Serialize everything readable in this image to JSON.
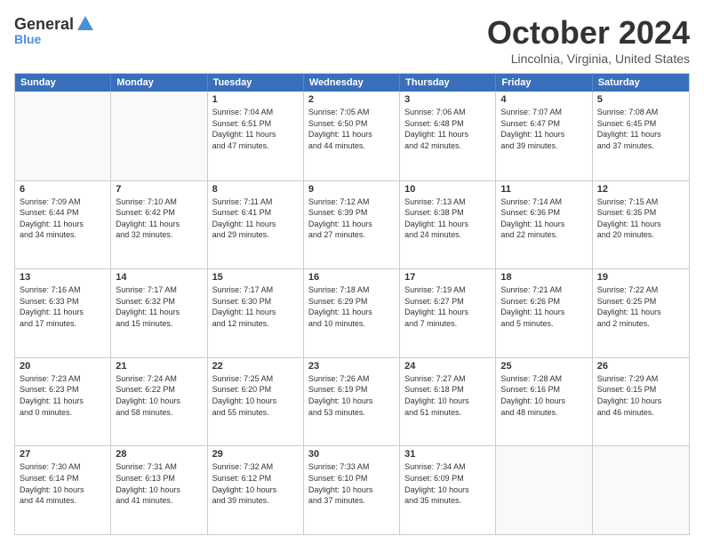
{
  "logo": {
    "general": "General",
    "blue": "Blue"
  },
  "header": {
    "month": "October 2024",
    "location": "Lincolnia, Virginia, United States"
  },
  "days": [
    "Sunday",
    "Monday",
    "Tuesday",
    "Wednesday",
    "Thursday",
    "Friday",
    "Saturday"
  ],
  "weeks": [
    [
      {
        "day": "",
        "empty": true
      },
      {
        "day": "",
        "empty": true
      },
      {
        "day": "1",
        "lines": [
          "Sunrise: 7:04 AM",
          "Sunset: 6:51 PM",
          "Daylight: 11 hours",
          "and 47 minutes."
        ]
      },
      {
        "day": "2",
        "lines": [
          "Sunrise: 7:05 AM",
          "Sunset: 6:50 PM",
          "Daylight: 11 hours",
          "and 44 minutes."
        ]
      },
      {
        "day": "3",
        "lines": [
          "Sunrise: 7:06 AM",
          "Sunset: 6:48 PM",
          "Daylight: 11 hours",
          "and 42 minutes."
        ]
      },
      {
        "day": "4",
        "lines": [
          "Sunrise: 7:07 AM",
          "Sunset: 6:47 PM",
          "Daylight: 11 hours",
          "and 39 minutes."
        ]
      },
      {
        "day": "5",
        "lines": [
          "Sunrise: 7:08 AM",
          "Sunset: 6:45 PM",
          "Daylight: 11 hours",
          "and 37 minutes."
        ]
      }
    ],
    [
      {
        "day": "6",
        "lines": [
          "Sunrise: 7:09 AM",
          "Sunset: 6:44 PM",
          "Daylight: 11 hours",
          "and 34 minutes."
        ]
      },
      {
        "day": "7",
        "lines": [
          "Sunrise: 7:10 AM",
          "Sunset: 6:42 PM",
          "Daylight: 11 hours",
          "and 32 minutes."
        ]
      },
      {
        "day": "8",
        "lines": [
          "Sunrise: 7:11 AM",
          "Sunset: 6:41 PM",
          "Daylight: 11 hours",
          "and 29 minutes."
        ]
      },
      {
        "day": "9",
        "lines": [
          "Sunrise: 7:12 AM",
          "Sunset: 6:39 PM",
          "Daylight: 11 hours",
          "and 27 minutes."
        ]
      },
      {
        "day": "10",
        "lines": [
          "Sunrise: 7:13 AM",
          "Sunset: 6:38 PM",
          "Daylight: 11 hours",
          "and 24 minutes."
        ]
      },
      {
        "day": "11",
        "lines": [
          "Sunrise: 7:14 AM",
          "Sunset: 6:36 PM",
          "Daylight: 11 hours",
          "and 22 minutes."
        ]
      },
      {
        "day": "12",
        "lines": [
          "Sunrise: 7:15 AM",
          "Sunset: 6:35 PM",
          "Daylight: 11 hours",
          "and 20 minutes."
        ]
      }
    ],
    [
      {
        "day": "13",
        "lines": [
          "Sunrise: 7:16 AM",
          "Sunset: 6:33 PM",
          "Daylight: 11 hours",
          "and 17 minutes."
        ]
      },
      {
        "day": "14",
        "lines": [
          "Sunrise: 7:17 AM",
          "Sunset: 6:32 PM",
          "Daylight: 11 hours",
          "and 15 minutes."
        ]
      },
      {
        "day": "15",
        "lines": [
          "Sunrise: 7:17 AM",
          "Sunset: 6:30 PM",
          "Daylight: 11 hours",
          "and 12 minutes."
        ]
      },
      {
        "day": "16",
        "lines": [
          "Sunrise: 7:18 AM",
          "Sunset: 6:29 PM",
          "Daylight: 11 hours",
          "and 10 minutes."
        ]
      },
      {
        "day": "17",
        "lines": [
          "Sunrise: 7:19 AM",
          "Sunset: 6:27 PM",
          "Daylight: 11 hours",
          "and 7 minutes."
        ]
      },
      {
        "day": "18",
        "lines": [
          "Sunrise: 7:21 AM",
          "Sunset: 6:26 PM",
          "Daylight: 11 hours",
          "and 5 minutes."
        ]
      },
      {
        "day": "19",
        "lines": [
          "Sunrise: 7:22 AM",
          "Sunset: 6:25 PM",
          "Daylight: 11 hours",
          "and 2 minutes."
        ]
      }
    ],
    [
      {
        "day": "20",
        "lines": [
          "Sunrise: 7:23 AM",
          "Sunset: 6:23 PM",
          "Daylight: 11 hours",
          "and 0 minutes."
        ]
      },
      {
        "day": "21",
        "lines": [
          "Sunrise: 7:24 AM",
          "Sunset: 6:22 PM",
          "Daylight: 10 hours",
          "and 58 minutes."
        ]
      },
      {
        "day": "22",
        "lines": [
          "Sunrise: 7:25 AM",
          "Sunset: 6:20 PM",
          "Daylight: 10 hours",
          "and 55 minutes."
        ]
      },
      {
        "day": "23",
        "lines": [
          "Sunrise: 7:26 AM",
          "Sunset: 6:19 PM",
          "Daylight: 10 hours",
          "and 53 minutes."
        ]
      },
      {
        "day": "24",
        "lines": [
          "Sunrise: 7:27 AM",
          "Sunset: 6:18 PM",
          "Daylight: 10 hours",
          "and 51 minutes."
        ]
      },
      {
        "day": "25",
        "lines": [
          "Sunrise: 7:28 AM",
          "Sunset: 6:16 PM",
          "Daylight: 10 hours",
          "and 48 minutes."
        ]
      },
      {
        "day": "26",
        "lines": [
          "Sunrise: 7:29 AM",
          "Sunset: 6:15 PM",
          "Daylight: 10 hours",
          "and 46 minutes."
        ]
      }
    ],
    [
      {
        "day": "27",
        "lines": [
          "Sunrise: 7:30 AM",
          "Sunset: 6:14 PM",
          "Daylight: 10 hours",
          "and 44 minutes."
        ]
      },
      {
        "day": "28",
        "lines": [
          "Sunrise: 7:31 AM",
          "Sunset: 6:13 PM",
          "Daylight: 10 hours",
          "and 41 minutes."
        ]
      },
      {
        "day": "29",
        "lines": [
          "Sunrise: 7:32 AM",
          "Sunset: 6:12 PM",
          "Daylight: 10 hours",
          "and 39 minutes."
        ]
      },
      {
        "day": "30",
        "lines": [
          "Sunrise: 7:33 AM",
          "Sunset: 6:10 PM",
          "Daylight: 10 hours",
          "and 37 minutes."
        ]
      },
      {
        "day": "31",
        "lines": [
          "Sunrise: 7:34 AM",
          "Sunset: 6:09 PM",
          "Daylight: 10 hours",
          "and 35 minutes."
        ]
      },
      {
        "day": "",
        "empty": true
      },
      {
        "day": "",
        "empty": true
      }
    ]
  ]
}
